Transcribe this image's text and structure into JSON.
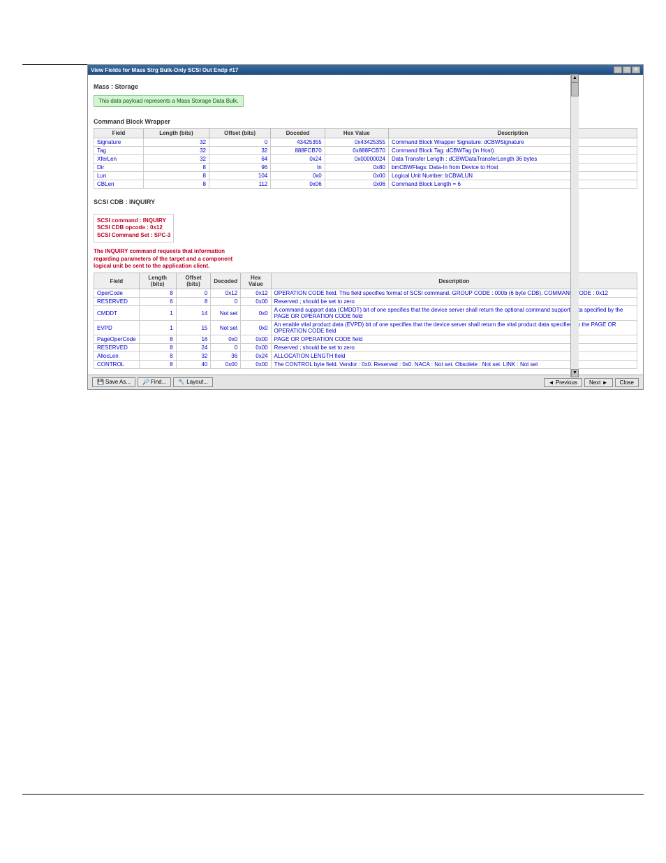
{
  "window": {
    "title": "View Fields for Mass Strg Bulk-Only SCSI Out Endp #17",
    "min": "_",
    "max": "□",
    "close": "×"
  },
  "header": "Mass : Storage",
  "badge": "This data payload represents a Mass Storage Data Bulk.",
  "section1": {
    "title": "Command Block Wrapper",
    "headers": [
      "Field",
      "Length (bits)",
      "Offset (bits)",
      "Doceded",
      "Hex Value",
      "Description"
    ],
    "rows": [
      {
        "f": "Signature",
        "l": "32",
        "o": "0",
        "d": "43425355",
        "h": "0x43425355",
        "desc": "Command Block Wrapper Signature: dCBWSignature"
      },
      {
        "f": "Tag",
        "l": "32",
        "o": "32",
        "d": "888FCB70",
        "h": "0x888FCB70",
        "desc": "Command Block Tag: dCBWTag (in Host)"
      },
      {
        "f": "XferLen",
        "l": "32",
        "o": "64",
        "d": "0x24",
        "h": "0x00000024",
        "desc": "Data Transfer Length : dCBWDataTransferLength 36 bytes"
      },
      {
        "f": "Dir",
        "l": "8",
        "o": "96",
        "d": "In",
        "h": "0x80",
        "desc": "bmCBWFlags: Data-In from Device to Host"
      },
      {
        "f": "Lun",
        "l": "8",
        "o": "104",
        "d": "0x0",
        "h": "0x00",
        "desc": "Logical Unit Number: bCBWLUN"
      },
      {
        "f": "CBLen",
        "l": "8",
        "o": "112",
        "d": "0x06",
        "h": "0x06",
        "desc": "Command Block Length = 6"
      }
    ]
  },
  "scsi": {
    "title": "SCSI CDB : INQUIRY",
    "info": [
      "SCSI command : INQUIRY",
      "SCSI CDB opcode : 0x12",
      "SCSI Command Set : SPC-3"
    ],
    "note": "The INQUIRY command requests that information\nregarding parameters of the target and a component\nlogical unit be sent to the application client.",
    "headers": [
      "Field",
      "Length (bits)",
      "Offset (bits)",
      "Decoded",
      "Hex Value",
      "Description"
    ],
    "rows": [
      {
        "f": "OperCode",
        "l": "8",
        "o": "0",
        "d": "0x12",
        "h": "0x12",
        "desc": "OPERATION CODE field. This field specifies format of SCSI command. GROUP CODE : 000b (6 byte CDB). COMMAND CODE : 0x12"
      },
      {
        "f": "RESERVED",
        "l": "6",
        "o": "8",
        "d": "0",
        "h": "0x00",
        "desc": "Reserved ; should be set to zero"
      },
      {
        "f": "CMDDT",
        "l": "1",
        "o": "14",
        "d": "Not set",
        "h": "0x0",
        "desc": "A command support data (CMDDT) bit of one specifies that the device server shall return the optional command support data specified by the PAGE OR OPERATION CODE field"
      },
      {
        "f": "EVPD",
        "l": "1",
        "o": "15",
        "d": "Not set",
        "h": "0x0",
        "desc": "An enable vital product data (EVPD) bit of one specifies that the device server shall return the vital product data specified by the PAGE OR OPERATION CODE field"
      },
      {
        "f": "PageOperCode",
        "l": "8",
        "o": "16",
        "d": "0x0",
        "h": "0x00",
        "desc": "PAGE OR OPERATION CODE field"
      },
      {
        "f": "RESERVED",
        "l": "8",
        "o": "24",
        "d": "0",
        "h": "0x00",
        "desc": "Reserved ; should be set to zero"
      },
      {
        "f": "AllocLen",
        "l": "8",
        "o": "32",
        "d": "36",
        "h": "0x24",
        "desc": "ALLOCATION LENGTH field"
      },
      {
        "f": "CONTROL",
        "l": "8",
        "o": "40",
        "d": "0x00",
        "h": "0x00",
        "desc": "The CONTROL byte field. Vendor : 0x0. Reserved : 0x0. NACA : Not set. Obsolete : Not set. LINK : Not set"
      }
    ]
  },
  "buttons": {
    "saveas": "Save As...",
    "find": "Find...",
    "layout": "Layout...",
    "prev": "Previous",
    "next": "Next",
    "close": "Close"
  }
}
